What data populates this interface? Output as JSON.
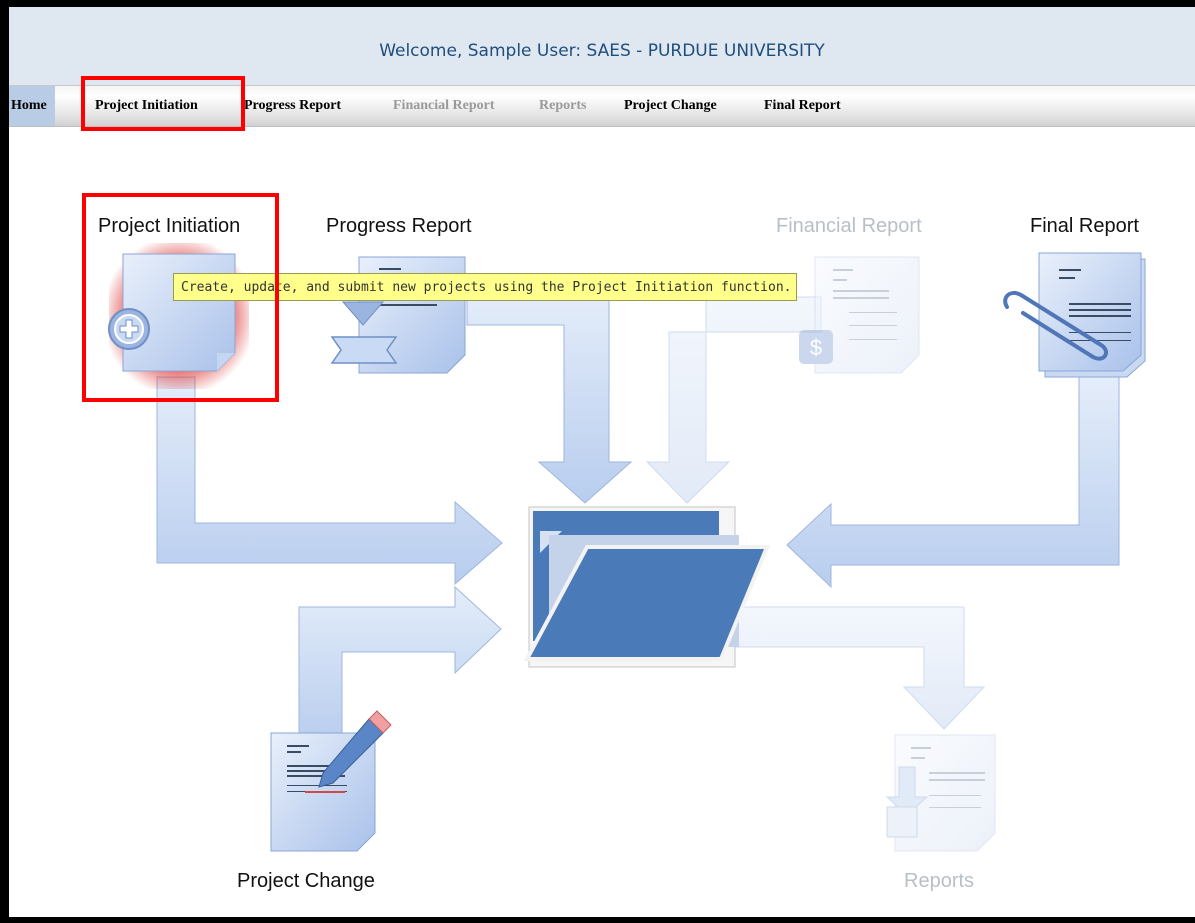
{
  "header": {
    "welcome": "Welcome, Sample User:  SAES - PURDUE UNIVERSITY"
  },
  "nav": {
    "items": [
      {
        "label": "Home"
      },
      {
        "label": "Project Initiation"
      },
      {
        "label": "Progress Report"
      },
      {
        "label": "Financial Report",
        "disabled": true
      },
      {
        "label": "Reports",
        "disabled": true
      },
      {
        "label": "Project Change"
      },
      {
        "label": "Final Report"
      }
    ]
  },
  "diagram": {
    "project_initiation": "Project Initiation",
    "progress_report": "Progress Report",
    "financial_report": "Financial Report",
    "final_report": "Final Report",
    "project_change": "Project Change",
    "reports": "Reports"
  },
  "tooltip": "Create, update, and submit new projects using the Project Initiation function.",
  "icons": {
    "project_initiation": "add-document-icon",
    "progress_report": "ribbon-document-icon",
    "financial_report": "dollar-document-icon",
    "final_report": "paperclip-document-icon",
    "project_change": "pencil-document-icon",
    "reports": "stacked-reports-icon",
    "center": "open-folder-icon"
  },
  "colors": {
    "accent": "#1f4e7c",
    "highlight": "#ff0000",
    "arrow": "#c9d9f2",
    "folder": "#4a7ab8",
    "tooltip_bg": "#ffff8c"
  }
}
